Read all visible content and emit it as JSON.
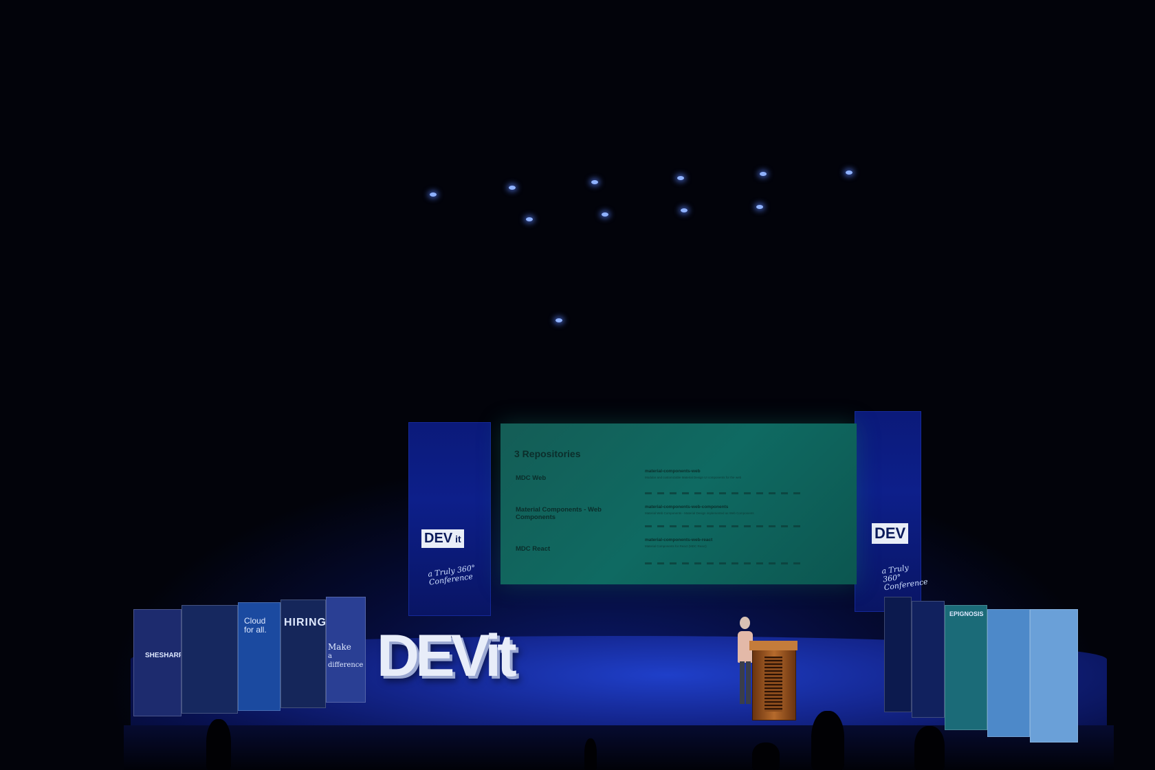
{
  "slide": {
    "title": "3 Repositories",
    "rows": [
      {
        "name": "MDC Web",
        "repo": "material-components-web",
        "description": "Modular and customizable Material Design UI components for the web"
      },
      {
        "name": "Material Components - Web Components",
        "repo": "material-components-web-components",
        "description": "Material Web Components - Material Design implemented as Web Components"
      },
      {
        "name": "MDC React",
        "repo": "material-components-web-react",
        "description": "Material Components for React (MDC React)"
      }
    ]
  },
  "banners": {
    "left_logo": "DEV",
    "left_logo_suffix": "it",
    "right_logo": "DEV",
    "tagline_line1": "a Truly 360°",
    "tagline_line2": "Conference"
  },
  "stage_sign": "DEVit",
  "rollups": {
    "shesharp": "SHESHARP",
    "cloud_line1": "Cloud",
    "cloud_line2": "for all.",
    "hiring": "HIRING!",
    "make_line1": "Make",
    "make_line2": "a difference",
    "epignosis": "EPIGNOSIS"
  },
  "colors": {
    "screen": "#0f6a62",
    "stage_light": "#1f3fc9",
    "background": "#02030a"
  }
}
